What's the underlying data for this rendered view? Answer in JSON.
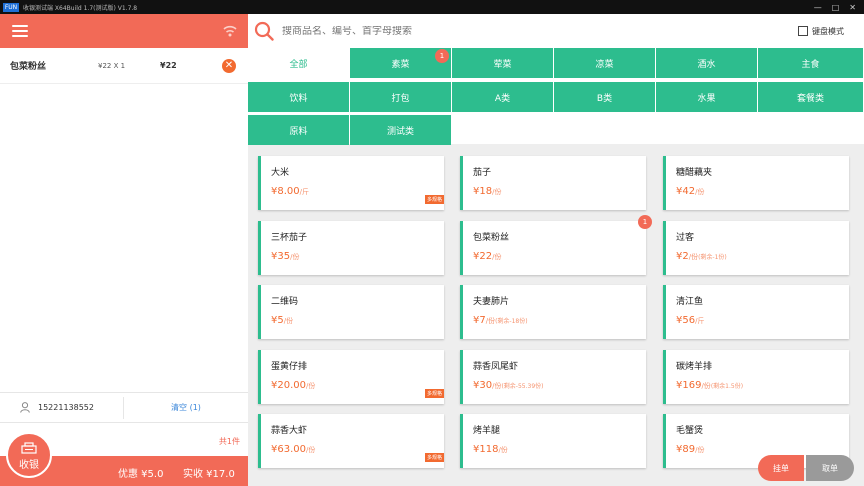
{
  "window": {
    "logo": "FUN",
    "title": "收银测试端 X64Build 1.7(测试版) V1.7.8"
  },
  "order": {
    "items": [
      {
        "name": "包菜粉丝",
        "price_qty": "¥22 X 1",
        "amount": "¥22"
      }
    ],
    "member_phone": "15221138552",
    "clear_label": "清空",
    "clear_count": "(1)",
    "total_label": "共1件",
    "discount": "优惠 ¥5.0",
    "paid": "实收 ¥17.0",
    "checkout_label": "收银"
  },
  "search": {
    "placeholder": "搜商品名、编号、首字母搜索",
    "keyboard_mode": "键盘模式"
  },
  "categories": [
    {
      "label": "全部",
      "active": true
    },
    {
      "label": "素菜"
    },
    {
      "label": "荤菜"
    },
    {
      "label": "凉菜"
    },
    {
      "label": "酒水"
    },
    {
      "label": "主食"
    },
    {
      "label": "饮料"
    },
    {
      "label": "打包"
    },
    {
      "label": "A类"
    },
    {
      "label": "B类"
    },
    {
      "label": "水果"
    },
    {
      "label": "套餐类"
    },
    {
      "label": "原料"
    },
    {
      "label": "测试类"
    }
  ],
  "category_badge": "1",
  "products": [
    {
      "name": "大米",
      "price": "¥8.00",
      "unit": "/斤",
      "tag": "多规格"
    },
    {
      "name": "茄子",
      "price": "¥18",
      "unit": "/份"
    },
    {
      "name": "糖醋藕夹",
      "price": "¥42",
      "unit": "/份"
    },
    {
      "name": "三杯茄子",
      "price": "¥35",
      "unit": "/份"
    },
    {
      "name": "包菜粉丝",
      "price": "¥22",
      "unit": "/份",
      "badge": "1"
    },
    {
      "name": "过客",
      "price": "¥2",
      "unit": "/份",
      "remain": "(剩余-1份)"
    },
    {
      "name": "二维码",
      "price": "¥5",
      "unit": "/份"
    },
    {
      "name": "夫妻肺片",
      "price": "¥7",
      "unit": "/份",
      "remain": "(剩余-18份)"
    },
    {
      "name": "清江鱼",
      "price": "¥56",
      "unit": "/斤"
    },
    {
      "name": "蛋黄仔排",
      "price": "¥20.00",
      "unit": "/份",
      "tag": "多规格"
    },
    {
      "name": "蒜香凤尾虾",
      "price": "¥30",
      "unit": "/份",
      "remain": "(剩余-55.39份)"
    },
    {
      "name": "碳烤羊排",
      "price": "¥169",
      "unit": "/份",
      "remain": "(剩余1.5份)"
    },
    {
      "name": "蒜香大虾",
      "price": "¥63.00",
      "unit": "/份",
      "tag": "多规格"
    },
    {
      "name": "烤羊腿",
      "price": "¥118",
      "unit": "/份"
    },
    {
      "name": "毛蟹煲",
      "price": "¥89",
      "unit": "/份"
    }
  ],
  "actions": {
    "hang": "挂单",
    "take": "取单"
  },
  "colors": {
    "accent": "#f26a57",
    "green": "#2dbd8e"
  }
}
